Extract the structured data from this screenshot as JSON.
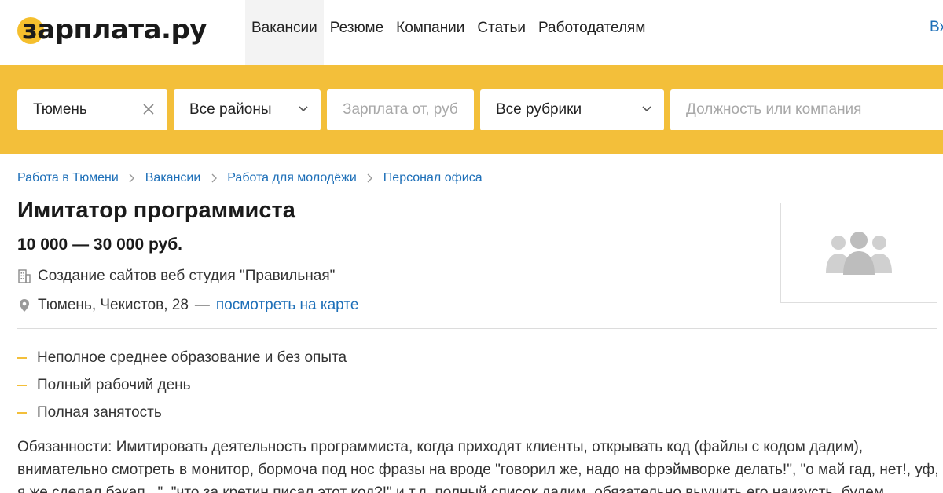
{
  "header": {
    "logo_text": "зарплата.ру",
    "nav": [
      {
        "label": "Вакансии"
      },
      {
        "label": "Резюме"
      },
      {
        "label": "Компании"
      },
      {
        "label": "Статьи"
      },
      {
        "label": "Работодателям"
      }
    ],
    "login_partial": "Вх"
  },
  "search": {
    "city_value": "Тюмень",
    "district_value": "Все районы",
    "salary_placeholder": "Зарплата от, руб",
    "rubric_value": "Все рубрики",
    "position_placeholder": "Должность или компания"
  },
  "breadcrumbs": [
    {
      "label": "Работа в Тюмени"
    },
    {
      "label": "Вакансии"
    },
    {
      "label": "Работа для молодёжи"
    },
    {
      "label": "Персонал офиса"
    }
  ],
  "vacancy": {
    "title": "Имитатор программиста",
    "salary": "10 000 — 30 000 руб.",
    "company": "Создание сайтов веб студия \"Правильная\"",
    "address": "Тюмень, Чекистов, 28",
    "address_sep": "—",
    "map_link": "посмотреть на карте",
    "requirements": [
      {
        "label": "Неполное среднее образование и без опыта"
      },
      {
        "label": "Полный рабочий день"
      },
      {
        "label": "Полная занятость"
      }
    ],
    "description_lines": [
      "Обязанности: Имитировать деятельность программиста, когда приходят клиенты, открывать код (файлы с кодом дадим),",
      "внимательно смотреть в монитор, бормоча под нос фразы на вроде \"говорил же, надо на фрэймворке делать!\", \"о май гад, нет!, уф,",
      "я же сделал бэкап...\", \"что за кретин писал этот код?!\" и т.д. полный список дадим, обязательно выучить его наизусть, будем"
    ]
  },
  "colors": {
    "accent_yellow": "#f3bf3a",
    "link_blue": "#1d6fb8"
  },
  "icons": {
    "clear": "close-icon",
    "dropdown": "chevron-down-icon",
    "company": "building-icon",
    "location": "map-pin-icon",
    "company_logo": "people-group-icon",
    "breadcrumb_separator": "chevron-right-icon"
  }
}
